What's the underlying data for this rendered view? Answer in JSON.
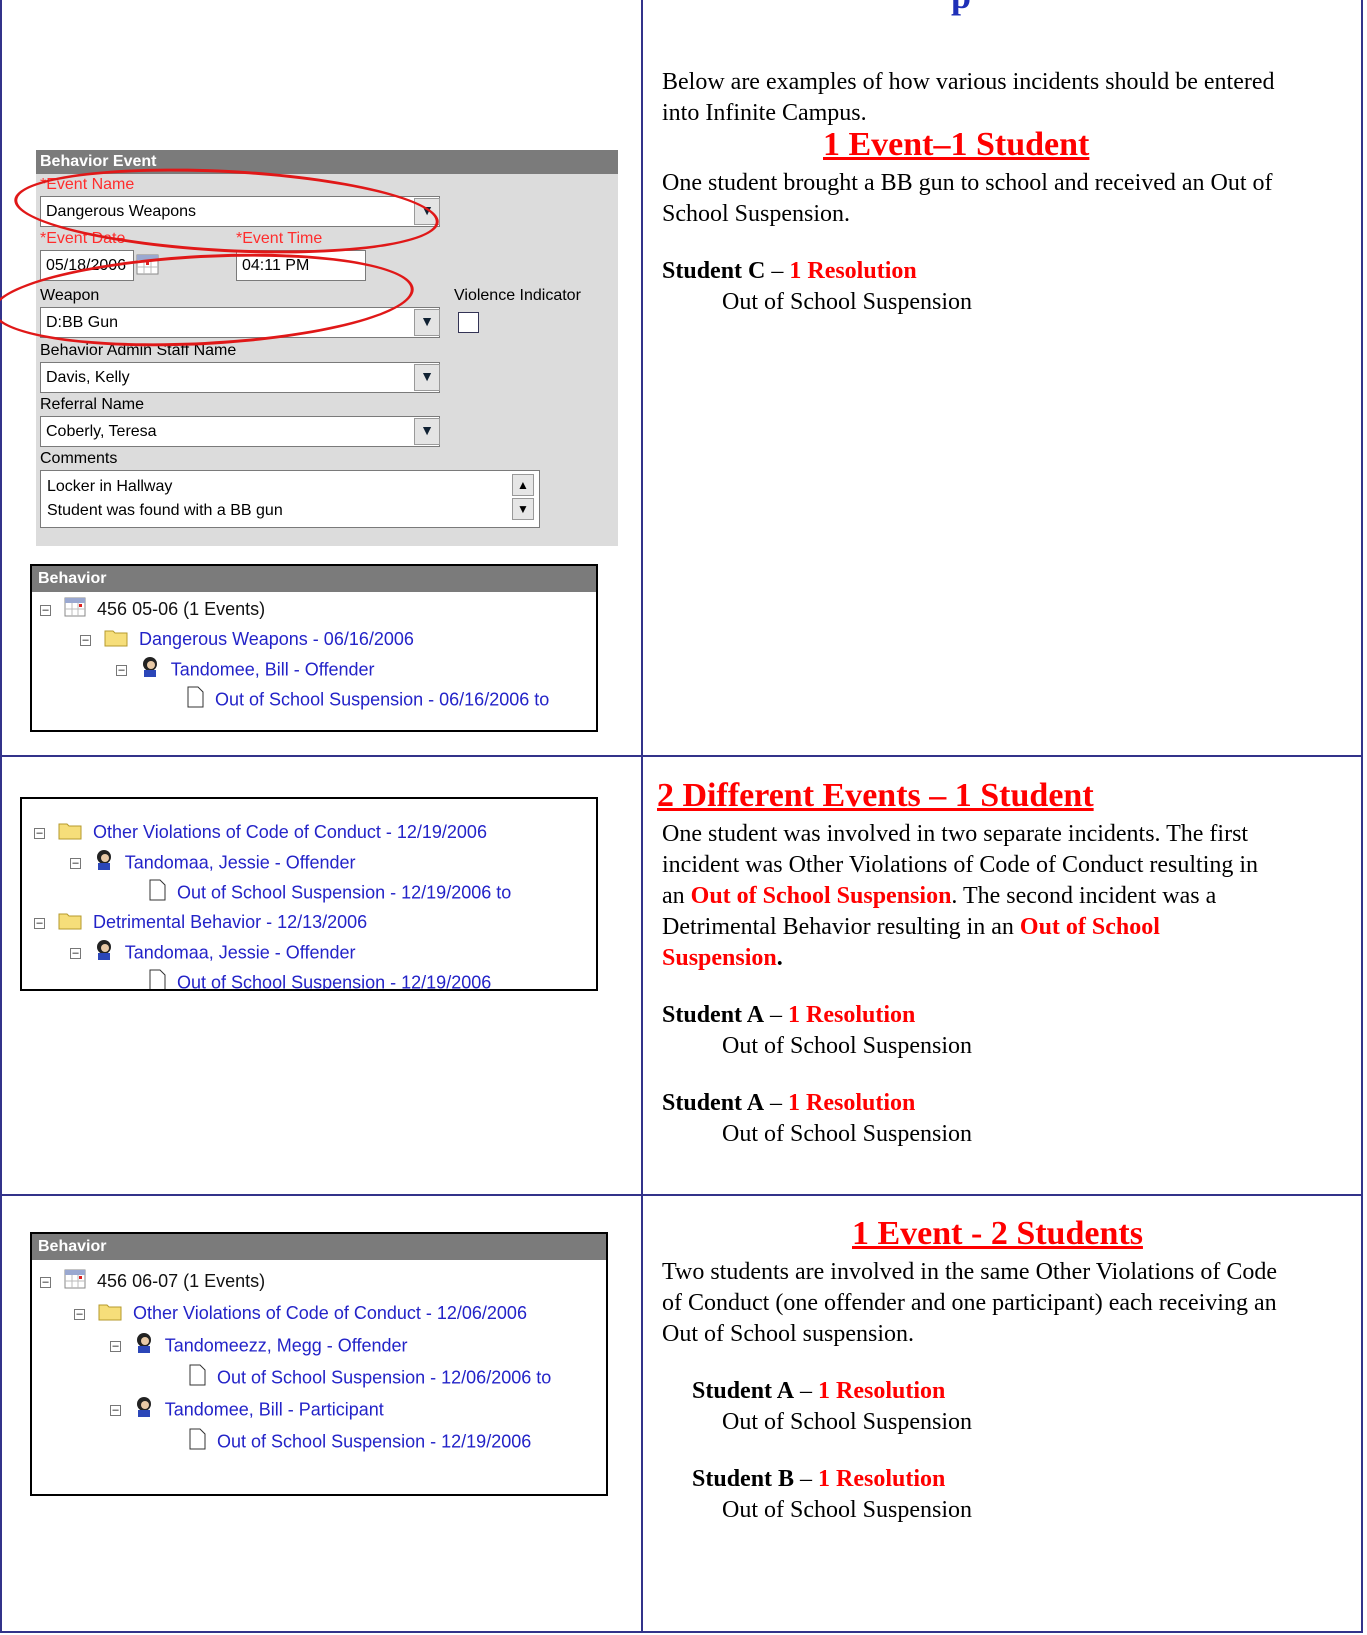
{
  "title_fragment": "p",
  "row1": {
    "intro": [
      "Below are examples of how various incidents should be entered",
      "into Infinite Campus."
    ],
    "heading": "1 Event–1 Student",
    "desc": [
      "One student brought a BB gun to school and received an Out of",
      "School Suspension."
    ],
    "student_label": "Student C",
    "dash": " – ",
    "resolution": "1 Resolution",
    "outcome": "Out of School Suspension",
    "form": {
      "header": "Behavior Event",
      "event_name_label": "*Event Name",
      "event_name_value": "Dangerous Weapons",
      "event_date_label": "*Event Date",
      "event_date_value": "05/18/2006",
      "event_time_label": "*Event Time",
      "event_time_value": "04:11 PM",
      "weapon_label": "Weapon",
      "weapon_value": "D:BB Gun",
      "violence_label": "Violence Indicator",
      "violence_checked": false,
      "staff_label": "Behavior Admin Staff Name",
      "staff_value": "Davis, Kelly",
      "referral_label": "Referral Name",
      "referral_value": "Coberly, Teresa",
      "comments_label": "Comments",
      "comments_line1": "Locker in Hallway",
      "comments_line2": "Student was found with a BB gun"
    },
    "tree": {
      "header": "Behavior",
      "year": "456 05-06 (1 Events)",
      "event": "Dangerous Weapons - 06/16/2006",
      "person": "Tandomee, Bill - Offender",
      "resolution": "Out of School Suspension - 06/16/2006 to"
    }
  },
  "row2": {
    "heading": "2 Different Events – 1 Student",
    "desc_l1": "One student was involved in two separate incidents.  The first",
    "desc_l2": "incident was Other Violations of Code of Conduct resulting in",
    "desc_l3a": "an ",
    "desc_l3b": "Out of School Suspension",
    "desc_l3c": ".  The second incident was a",
    "desc_l4a": "Detrimental Behavior resulting in an ",
    "desc_l4b": "Out of School",
    "desc_l5a": "Suspension",
    "desc_l5b": ".",
    "s1_label": "Student A",
    "s1_res": "1 Resolution",
    "s1_outcome": "Out of School Suspension",
    "s2_label": "Student A",
    "s2_res": "1 Resolution",
    "s2_outcome": "Out of School Suspension",
    "tree": {
      "event1": "Other Violations of Code of Conduct - 12/19/2006",
      "person1": "Tandomaa, Jessie - Offender",
      "res1": "Out of School Suspension - 12/19/2006 to",
      "event2": "Detrimental Behavior - 12/13/2006",
      "person2": "Tandomaa, Jessie - Offender",
      "res2": "Out of School Suspension - 12/19/2006"
    }
  },
  "row3": {
    "heading": "1 Event - 2 Students",
    "desc": [
      "Two students are involved in the same Other Violations of Code",
      "of Conduct (one offender and one participant) each receiving an",
      "Out of School suspension."
    ],
    "s1_label": "Student A",
    "s1_res": "1 Resolution",
    "s1_outcome": "Out of School Suspension",
    "s2_label": "Student B",
    "s2_res": "1 Resolution",
    "s2_outcome": "Out of School Suspension",
    "tree": {
      "header": "Behavior",
      "year": "456 06-07 (1 Events)",
      "event": "Other Violations of Code of Conduct - 12/06/2006",
      "person1": "Tandomeezz, Megg - Offender",
      "res1": "Out of School Suspension - 12/06/2006 to",
      "person2": "Tandomee, Bill - Participant",
      "res2": "Out of School Suspension - 12/19/2006"
    }
  }
}
